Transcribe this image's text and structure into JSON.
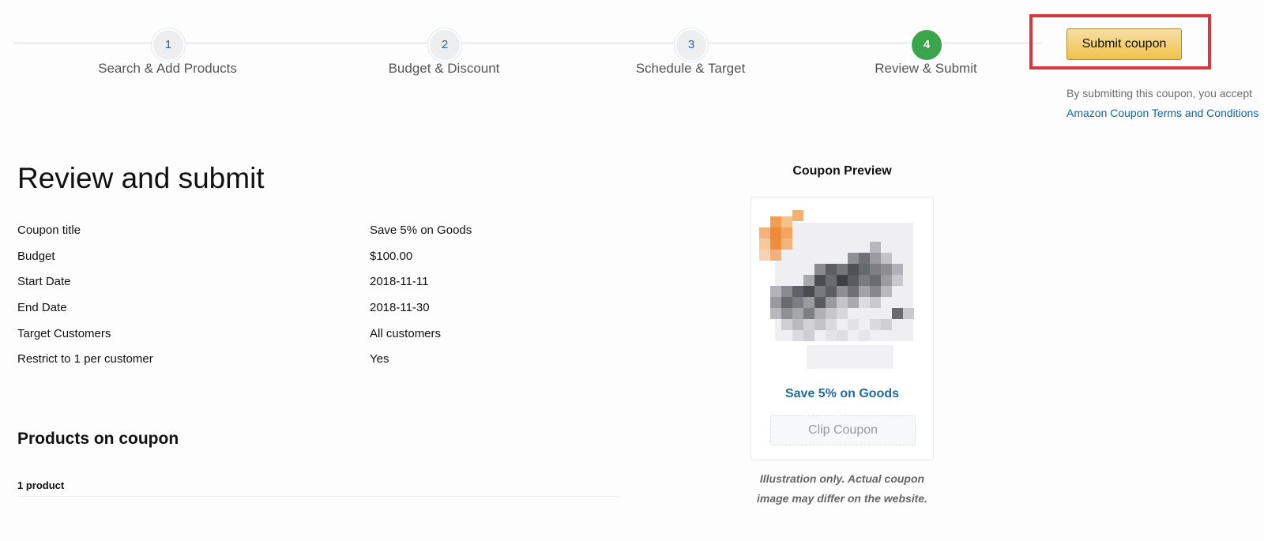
{
  "stepper": {
    "steps": [
      {
        "number": "1",
        "label": "Search & Add Products",
        "state": "complete"
      },
      {
        "number": "2",
        "label": "Budget & Discount",
        "state": "complete"
      },
      {
        "number": "3",
        "label": "Schedule & Target",
        "state": "complete"
      },
      {
        "number": "4",
        "label": "Review & Submit",
        "state": "active"
      }
    ],
    "active_color": "#3aa54a"
  },
  "submit": {
    "button_label": "Submit coupon",
    "terms_prefix": "By submitting this coupon, you accept ",
    "terms_link": "Amazon Coupon Terms and Conditions",
    "highlight_color": "#d9363e"
  },
  "review": {
    "title": "Review and submit",
    "rows": [
      {
        "label": "Coupon title",
        "value": "Save 5% on Goods"
      },
      {
        "label": "Budget",
        "value": "$100.00"
      },
      {
        "label": "Start Date",
        "value": "2018-11-11"
      },
      {
        "label": "End Date",
        "value": "2018-11-30"
      },
      {
        "label": "Target Customers",
        "value": "All customers"
      },
      {
        "label": "Restrict to 1 per customer",
        "value": "Yes"
      }
    ]
  },
  "products": {
    "heading": "Products on coupon",
    "count": "1 product"
  },
  "preview": {
    "heading": "Coupon Preview",
    "coupon_title": "Save 5% on Goods",
    "clip_label": "Clip Coupon",
    "disclaimer": "Illustration only. Actual coupon image may differ on the website.",
    "title_color": "#1f6b9d"
  }
}
